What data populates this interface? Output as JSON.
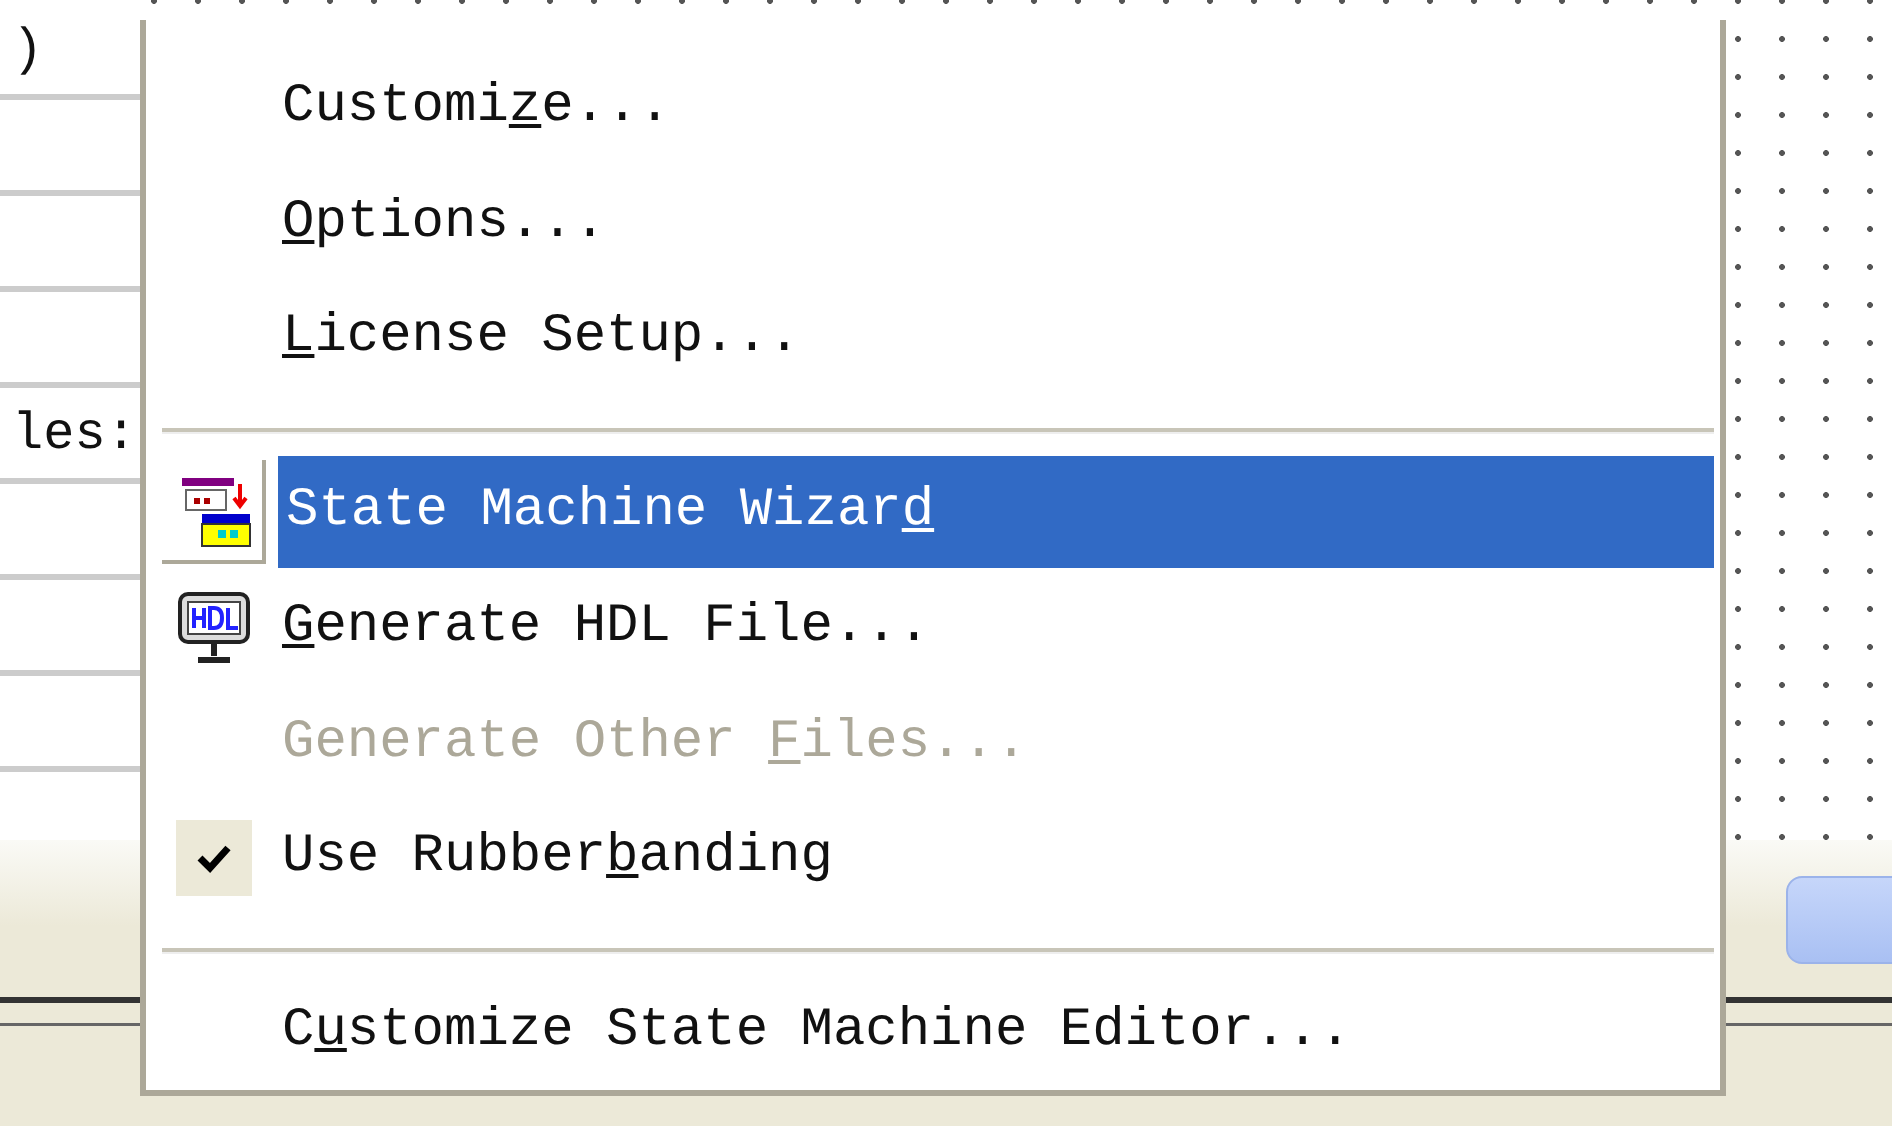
{
  "background": {
    "left_texts": [
      ")",
      "les:"
    ]
  },
  "menu": {
    "items": [
      {
        "kind": "plain",
        "text_before": "Customi",
        "access_key": "z",
        "text_after": "e...",
        "selected": false,
        "disabled": false,
        "checked": false
      },
      {
        "kind": "plain",
        "access_key": "O",
        "text_after": "ptions...",
        "selected": false,
        "disabled": false,
        "checked": false
      },
      {
        "kind": "plain",
        "access_key": "L",
        "text_after": "icense Setup...",
        "selected": false,
        "disabled": false,
        "checked": false
      },
      {
        "kind": "separator"
      },
      {
        "kind": "wizard",
        "text_before": "State Machine Wizar",
        "access_key": "d",
        "selected": true,
        "disabled": false,
        "checked": false
      },
      {
        "kind": "generate",
        "access_key": "G",
        "text_after": "enerate HDL File...",
        "selected": false,
        "disabled": false,
        "checked": false
      },
      {
        "kind": "plain",
        "text_before": "Generate Other ",
        "access_key": "F",
        "text_after": "iles...",
        "selected": false,
        "disabled": true,
        "checked": false
      },
      {
        "kind": "plain",
        "text_before": "Use Rubber",
        "access_key": "b",
        "text_after": "anding",
        "selected": false,
        "disabled": false,
        "checked": true
      },
      {
        "kind": "separator"
      },
      {
        "kind": "plain",
        "text_before": "C",
        "access_key": "u",
        "text_after": "stomize State Machine Editor...",
        "selected": false,
        "disabled": false,
        "checked": false
      }
    ]
  }
}
